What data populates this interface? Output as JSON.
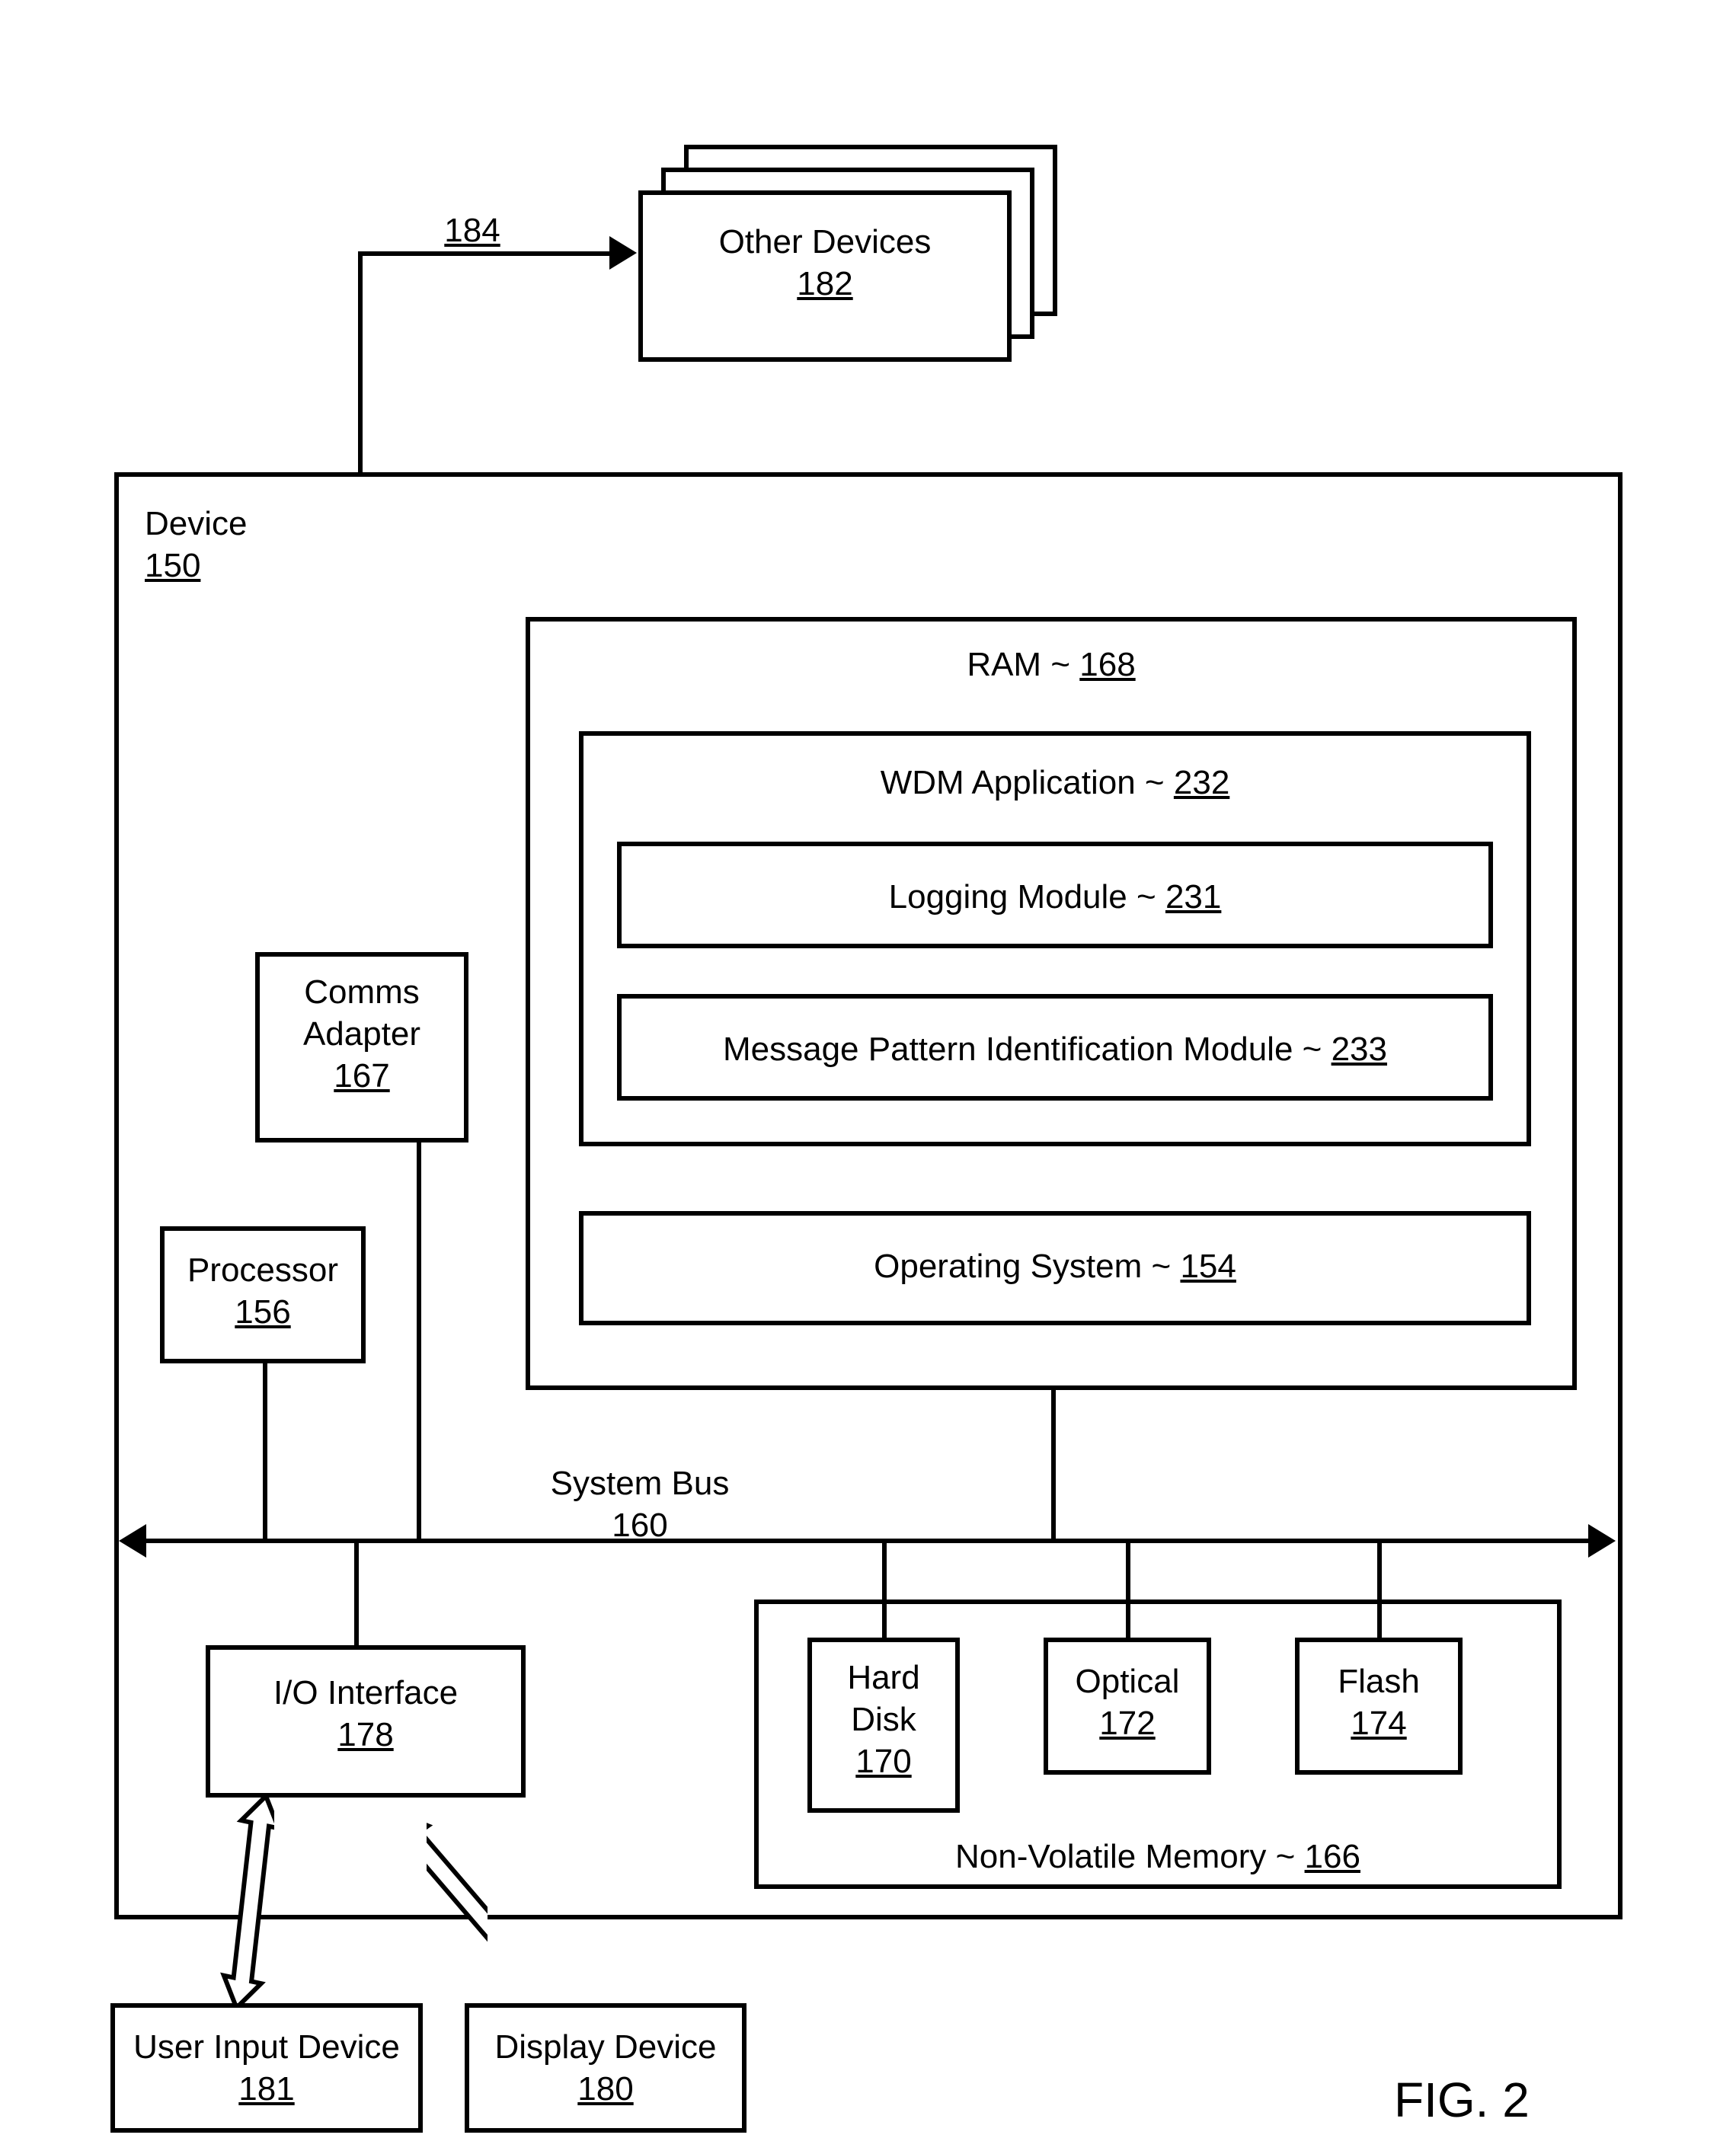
{
  "figure_label": "FIG. 2",
  "other_devices": {
    "text": "Other Devices",
    "num": "182"
  },
  "link_184": "184",
  "device": {
    "text": "Device",
    "num": "150"
  },
  "comms_adapter": {
    "text_l1": "Comms",
    "text_l2": "Adapter",
    "num": "167"
  },
  "processor": {
    "text": "Processor",
    "num": "156"
  },
  "ram": {
    "text": "RAM ~",
    "num": "168"
  },
  "wdm": {
    "text": "WDM Application ~",
    "num": "232"
  },
  "logging": {
    "text": "Logging Module ~",
    "num": "231"
  },
  "mpim": {
    "text": "Message Pattern Identification Module ~",
    "num": "233"
  },
  "os": {
    "text": "Operating System ~",
    "num": "154"
  },
  "system_bus": {
    "text": "System Bus",
    "num": "160"
  },
  "io_interface": {
    "text": "I/O Interface",
    "num": "178"
  },
  "nvmem": {
    "text": "Non-Volatile Memory ~",
    "num": "166"
  },
  "hard_disk": {
    "text_l1": "Hard",
    "text_l2": "Disk",
    "num": "170"
  },
  "optical": {
    "text": "Optical",
    "num": "172"
  },
  "flash": {
    "text": "Flash",
    "num": "174"
  },
  "user_input": {
    "text": "User Input Device",
    "num": "181"
  },
  "display_device": {
    "text": "Display Device",
    "num": "180"
  }
}
